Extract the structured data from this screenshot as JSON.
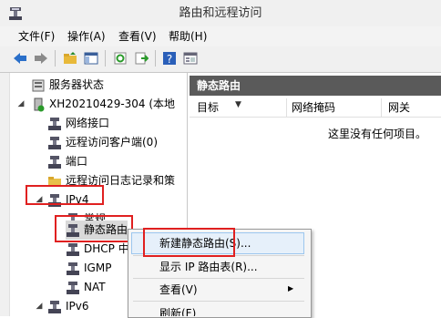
{
  "window": {
    "title": "路由和远程访问"
  },
  "menu": [
    "文件(F)",
    "操作(A)",
    "查看(V)",
    "帮助(H)"
  ],
  "toolbar": {
    "buttons": [
      "back-arrow-icon",
      "forward-arrow-icon",
      "up-folder-icon",
      "show-hide-tree-icon",
      "refresh-icon",
      "export-list-icon",
      "help-icon",
      "properties-icon"
    ]
  },
  "tree": {
    "server_status": "服务器状态",
    "server": "XH20210429-304 (本地",
    "network_interfaces": "网络接口",
    "remote_clients": "远程访问客户端(0)",
    "ports": "端口",
    "remote_logging": "远程访问日志记录和策",
    "ipv4": "IPv4",
    "general": "常规",
    "static_routes": "静态路由",
    "dhcp": "DHCP 中",
    "igmp": "IGMP",
    "nat": "NAT",
    "ipv6": "IPv6"
  },
  "pane": {
    "header": "静态路由",
    "columns": [
      "目标",
      "网络掩码",
      "网关"
    ],
    "empty_message": "这里没有任何项目。"
  },
  "context_menu": {
    "items": [
      "新建静态路由(S)...",
      "显示 IP 路由表(R)...",
      "查看(V)",
      "刷新(F)"
    ]
  },
  "colors": {
    "highlight_box": "#e02020",
    "header_bg": "#5a5a5a"
  }
}
